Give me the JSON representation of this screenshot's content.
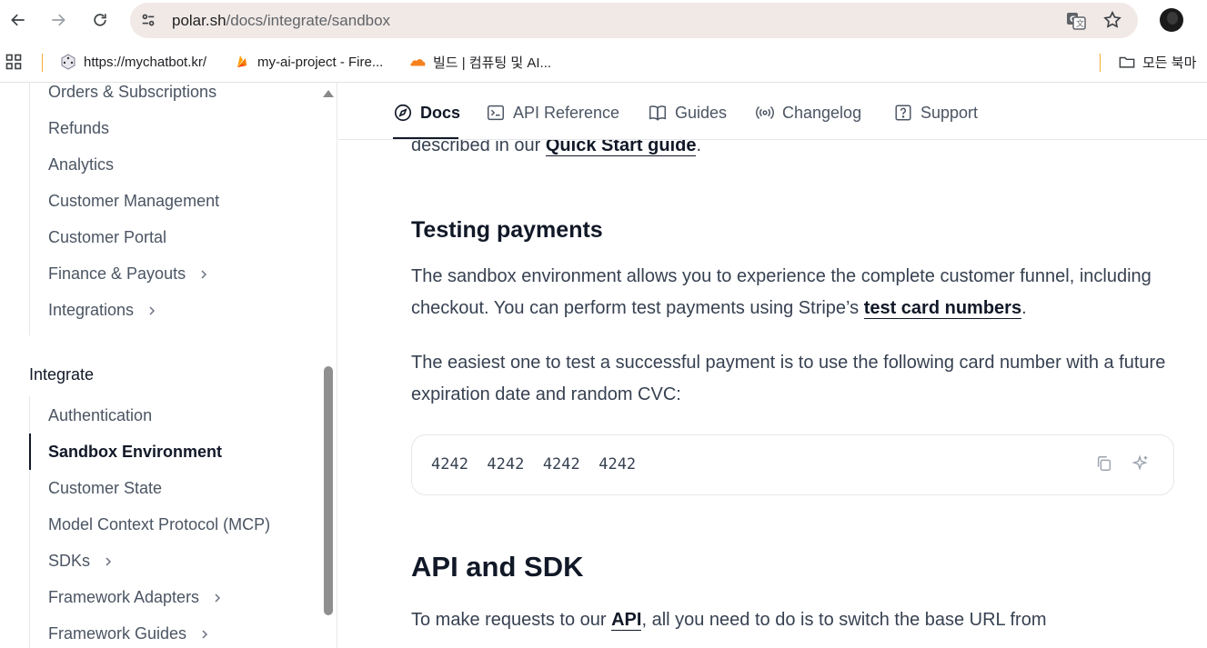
{
  "browser": {
    "url_host": "polar.sh",
    "url_path": "/docs/integrate/sandbox",
    "bookmarks": [
      {
        "label": "https://mychatbot.kr/",
        "icon": "dice-icon"
      },
      {
        "label": "my-ai-project - Fire...",
        "icon": "firebase-icon"
      },
      {
        "label": "빌드 | 컴퓨팅 및 AI...",
        "icon": "cloudflare-icon"
      },
      {
        "label": "모든 북마",
        "icon": "folder-icon"
      }
    ]
  },
  "sidebar": {
    "items_top": [
      {
        "label": "Orders & Subscriptions",
        "chevron": false
      },
      {
        "label": "Refunds",
        "chevron": false
      },
      {
        "label": "Analytics",
        "chevron": false
      },
      {
        "label": "Customer Management",
        "chevron": false
      },
      {
        "label": "Customer Portal",
        "chevron": false
      },
      {
        "label": "Finance & Payouts",
        "chevron": true
      },
      {
        "label": "Integrations",
        "chevron": true
      }
    ],
    "section_title": "Integrate",
    "items_integrate": [
      {
        "label": "Authentication",
        "chevron": false
      },
      {
        "label": "Sandbox Environment",
        "chevron": false,
        "active": true
      },
      {
        "label": "Customer State",
        "chevron": false
      },
      {
        "label": "Model Context Protocol (MCP)",
        "chevron": false
      },
      {
        "label": "SDKs",
        "chevron": true
      },
      {
        "label": "Framework Adapters",
        "chevron": true
      },
      {
        "label": "Framework Guides",
        "chevron": true
      }
    ]
  },
  "topnav": {
    "tabs": [
      {
        "label": "Docs",
        "icon": "compass-icon",
        "active": true
      },
      {
        "label": "API Reference",
        "icon": "terminal-icon"
      },
      {
        "label": "Guides",
        "icon": "book-icon"
      },
      {
        "label": "Changelog",
        "icon": "broadcast-icon"
      },
      {
        "label": "Support",
        "icon": "help-icon"
      }
    ]
  },
  "content": {
    "intro_text": "described in our ",
    "intro_link": "Quick Start guide",
    "intro_end": ".",
    "testing_heading": "Testing payments",
    "testing_p1_a": "The sandbox environment allows you to experience the complete customer funnel, including checkout. You can perform test payments using Stripe’s ",
    "testing_p1_link": "test card numbers",
    "testing_p1_end": ".",
    "testing_p2": "The easiest one to test a successful payment is to use the following card number with a future expiration date and random CVC:",
    "card_number": "4242  4242  4242  4242",
    "api_heading": "API and SDK",
    "api_p_a": "To make requests to our ",
    "api_p_link": "API",
    "api_p_b": ", all you need to do is to switch the base URL from"
  },
  "colors": {
    "address_bar": "#f1e9e6",
    "text_primary": "#111827",
    "text_secondary": "#4b5563"
  }
}
